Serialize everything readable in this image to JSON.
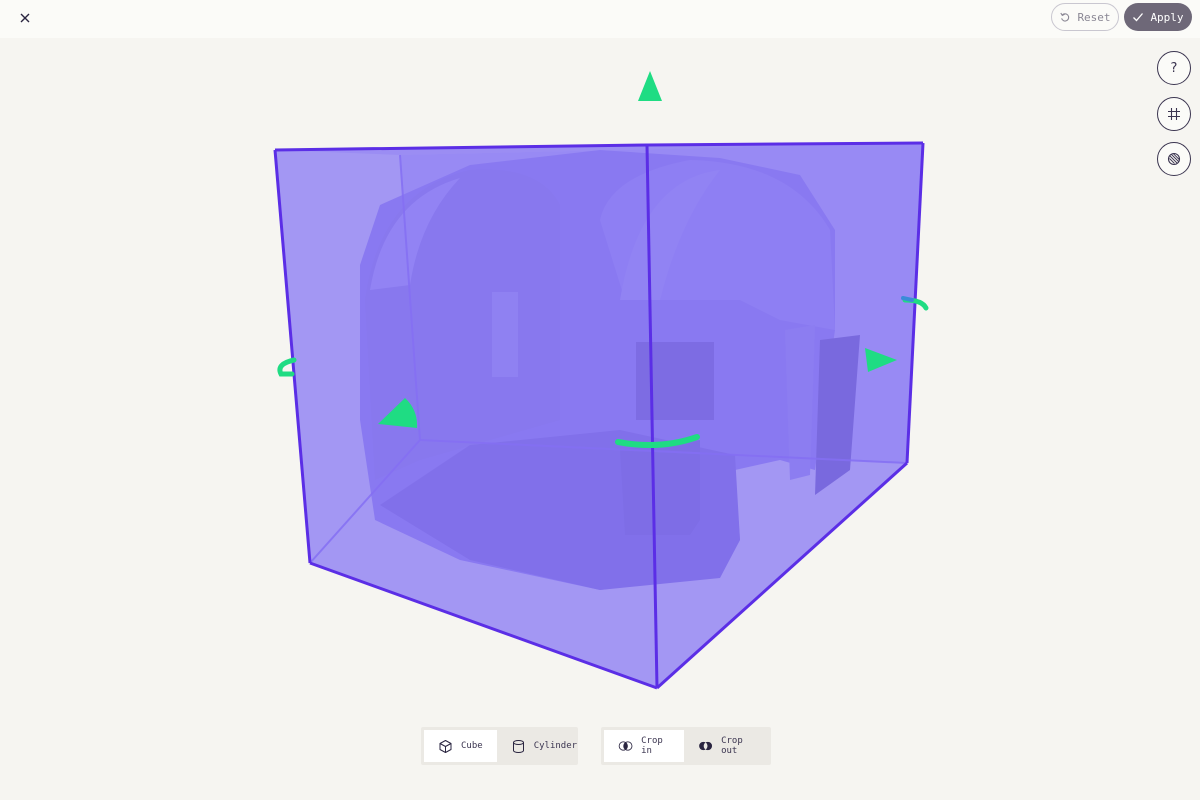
{
  "toolbar": {
    "reset_label": "Reset",
    "apply_label": "Apply"
  },
  "side_tools": [
    {
      "icon": "help-icon",
      "glyph": "?"
    },
    {
      "icon": "grid-icon"
    },
    {
      "icon": "texture-icon"
    }
  ],
  "shape_modes": {
    "selected": "Cube",
    "options": [
      "Cube",
      "Cylinder"
    ]
  },
  "crop_modes": {
    "selected": "Crop in",
    "options": [
      "Crop in",
      "Crop out"
    ]
  },
  "colors": {
    "box_fill": "#8c7cf4",
    "box_edge": "#5b2ee6",
    "gizmo": "#1fdc83",
    "apply_bg": "#6e6878"
  }
}
